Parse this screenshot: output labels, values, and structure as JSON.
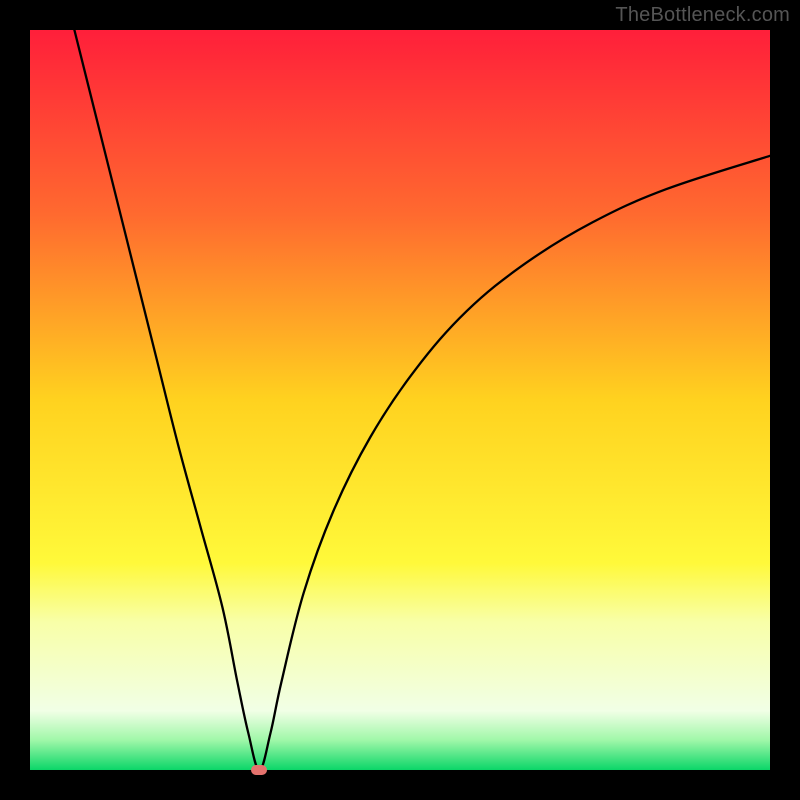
{
  "watermark": "TheBottleneck.com",
  "chart_data": {
    "type": "line",
    "title": "",
    "xlabel": "",
    "ylabel": "",
    "xlim": [
      0,
      100
    ],
    "ylim": [
      0,
      100
    ],
    "grid": false,
    "legend": false,
    "gradient_stops": [
      {
        "offset": 0,
        "color": "#ff1f3a"
      },
      {
        "offset": 0.25,
        "color": "#ff6a2f"
      },
      {
        "offset": 0.5,
        "color": "#ffd21f"
      },
      {
        "offset": 0.72,
        "color": "#fff93a"
      },
      {
        "offset": 0.8,
        "color": "#f8ffa8"
      },
      {
        "offset": 0.92,
        "color": "#f1ffe6"
      },
      {
        "offset": 0.96,
        "color": "#9ff7a8"
      },
      {
        "offset": 1.0,
        "color": "#0bd668"
      }
    ],
    "curve": {
      "stroke": "#000000",
      "stroke_width": 2.3,
      "dip_x": 31,
      "points": [
        {
          "x": 6.0,
          "y": 100.0
        },
        {
          "x": 8.0,
          "y": 92.0
        },
        {
          "x": 11.0,
          "y": 80.0
        },
        {
          "x": 14.0,
          "y": 68.0
        },
        {
          "x": 17.0,
          "y": 56.0
        },
        {
          "x": 20.0,
          "y": 44.0
        },
        {
          "x": 23.0,
          "y": 33.0
        },
        {
          "x": 26.0,
          "y": 22.0
        },
        {
          "x": 28.0,
          "y": 12.0
        },
        {
          "x": 29.5,
          "y": 5.0
        },
        {
          "x": 31.0,
          "y": 0.0
        },
        {
          "x": 32.5,
          "y": 5.0
        },
        {
          "x": 34.0,
          "y": 12.0
        },
        {
          "x": 37.0,
          "y": 24.0
        },
        {
          "x": 41.0,
          "y": 35.0
        },
        {
          "x": 46.0,
          "y": 45.0
        },
        {
          "x": 52.0,
          "y": 54.0
        },
        {
          "x": 59.0,
          "y": 62.0
        },
        {
          "x": 67.0,
          "y": 68.5
        },
        {
          "x": 76.0,
          "y": 74.0
        },
        {
          "x": 86.0,
          "y": 78.5
        },
        {
          "x": 100.0,
          "y": 83.0
        }
      ]
    },
    "dip_marker": {
      "x": 31,
      "y": 0,
      "color": "#e4726d"
    }
  }
}
